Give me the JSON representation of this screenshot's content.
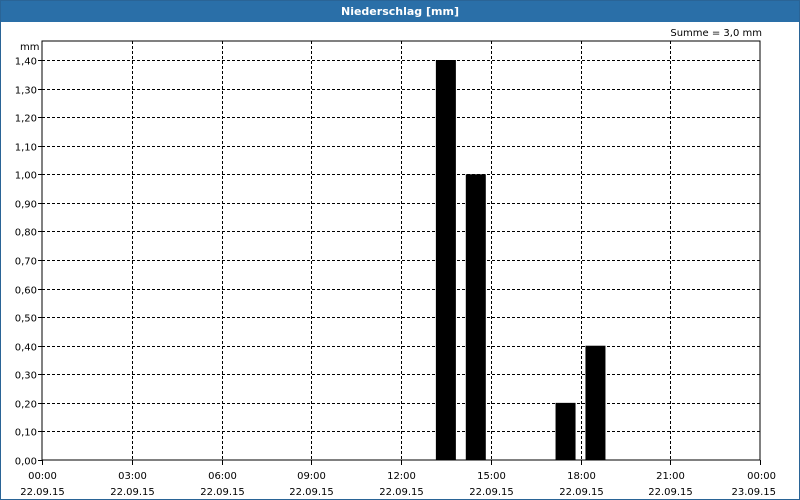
{
  "window": {
    "title": "Niederschlag [mm]"
  },
  "summary": "Summe = 3,0 mm",
  "chart_data": {
    "type": "bar",
    "title": "Niederschlag [mm]",
    "ylabel": "mm",
    "xlabel": "",
    "ylim": [
      0,
      1.4
    ],
    "ytick_labels": [
      "0,00",
      "0,10",
      "0,20",
      "0,30",
      "0,40",
      "0,50",
      "0,60",
      "0,70",
      "0,80",
      "0,90",
      "1,00",
      "1,10",
      "1,20",
      "1,30",
      "1,40"
    ],
    "xtick_times": [
      "00:00",
      "03:00",
      "06:00",
      "09:00",
      "12:00",
      "15:00",
      "18:00",
      "21:00",
      "00:00"
    ],
    "xtick_dates": [
      "22.09.15",
      "22.09.15",
      "22.09.15",
      "22.09.15",
      "22.09.15",
      "22.09.15",
      "22.09.15",
      "22.09.15",
      "23.09.15"
    ],
    "xlim_hours": [
      0,
      24
    ],
    "bar_color": "#000000",
    "grid": true,
    "series": [
      {
        "values": [
          {
            "x_hours": 13.5,
            "y": 1.4
          },
          {
            "x_hours": 14.5,
            "y": 1.0
          },
          {
            "x_hours": 17.5,
            "y": 0.2
          },
          {
            "x_hours": 18.5,
            "y": 0.4
          }
        ]
      }
    ]
  }
}
